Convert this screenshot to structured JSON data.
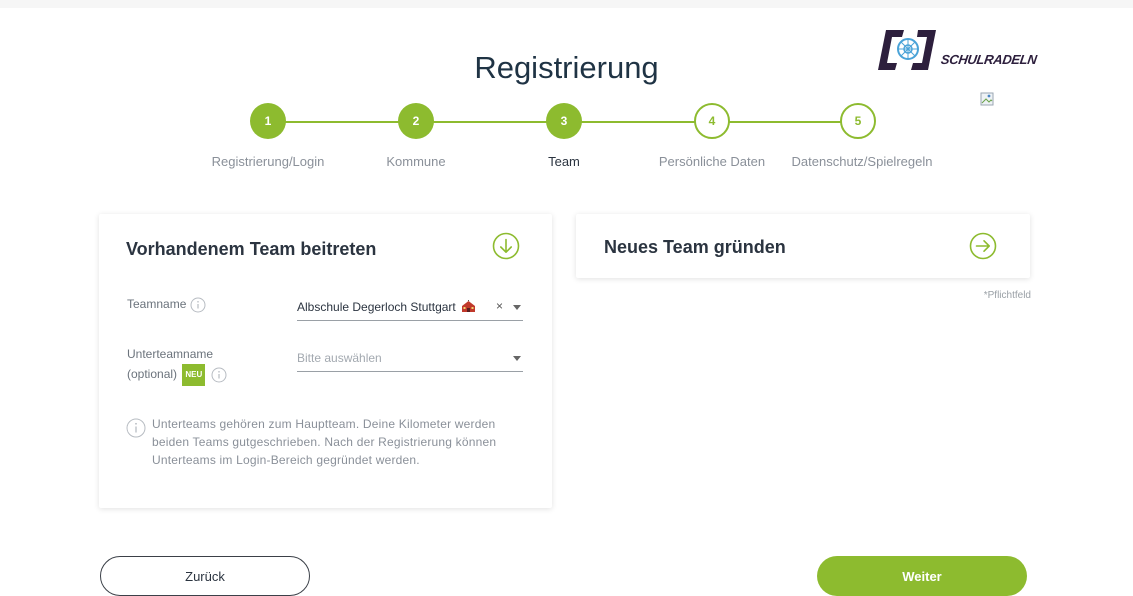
{
  "header": {
    "title": "Registrierung",
    "logo_text": "SCHULRADELN"
  },
  "steps": [
    {
      "number": "1",
      "label": "Registrierung/Login",
      "state": "done"
    },
    {
      "number": "2",
      "label": "Kommune",
      "state": "done"
    },
    {
      "number": "3",
      "label": "Team",
      "state": "active"
    },
    {
      "number": "4",
      "label": "Persönliche Daten",
      "state": "todo"
    },
    {
      "number": "5",
      "label": "Datenschutz/Spielregeln",
      "state": "todo"
    }
  ],
  "join_card": {
    "title": "Vorhandenem Team beitreten",
    "teamname_label": "Teamname",
    "teamname_value": "Albschule Degerloch Stuttgart",
    "clear_symbol": "×",
    "subteam_label_line1": "Unterteamname",
    "subteam_label_line2": "(optional)",
    "badge_new": "NEU",
    "subteam_placeholder": "Bitte auswählen",
    "note": "Unterteams gehören zum Hauptteam. Deine Kilometer werden beiden Teams gutgeschrieben. Nach der Registrierung können Unterteams im Login-Bereich gegründet werden."
  },
  "new_card": {
    "title": "Neues Team gründen"
  },
  "required_note": "*Pflichtfeld",
  "buttons": {
    "back": "Zurück",
    "next": "Weiter"
  },
  "colors": {
    "accent": "#8dbb2f",
    "title": "#1f3344",
    "logo": "#2d1f3d"
  }
}
